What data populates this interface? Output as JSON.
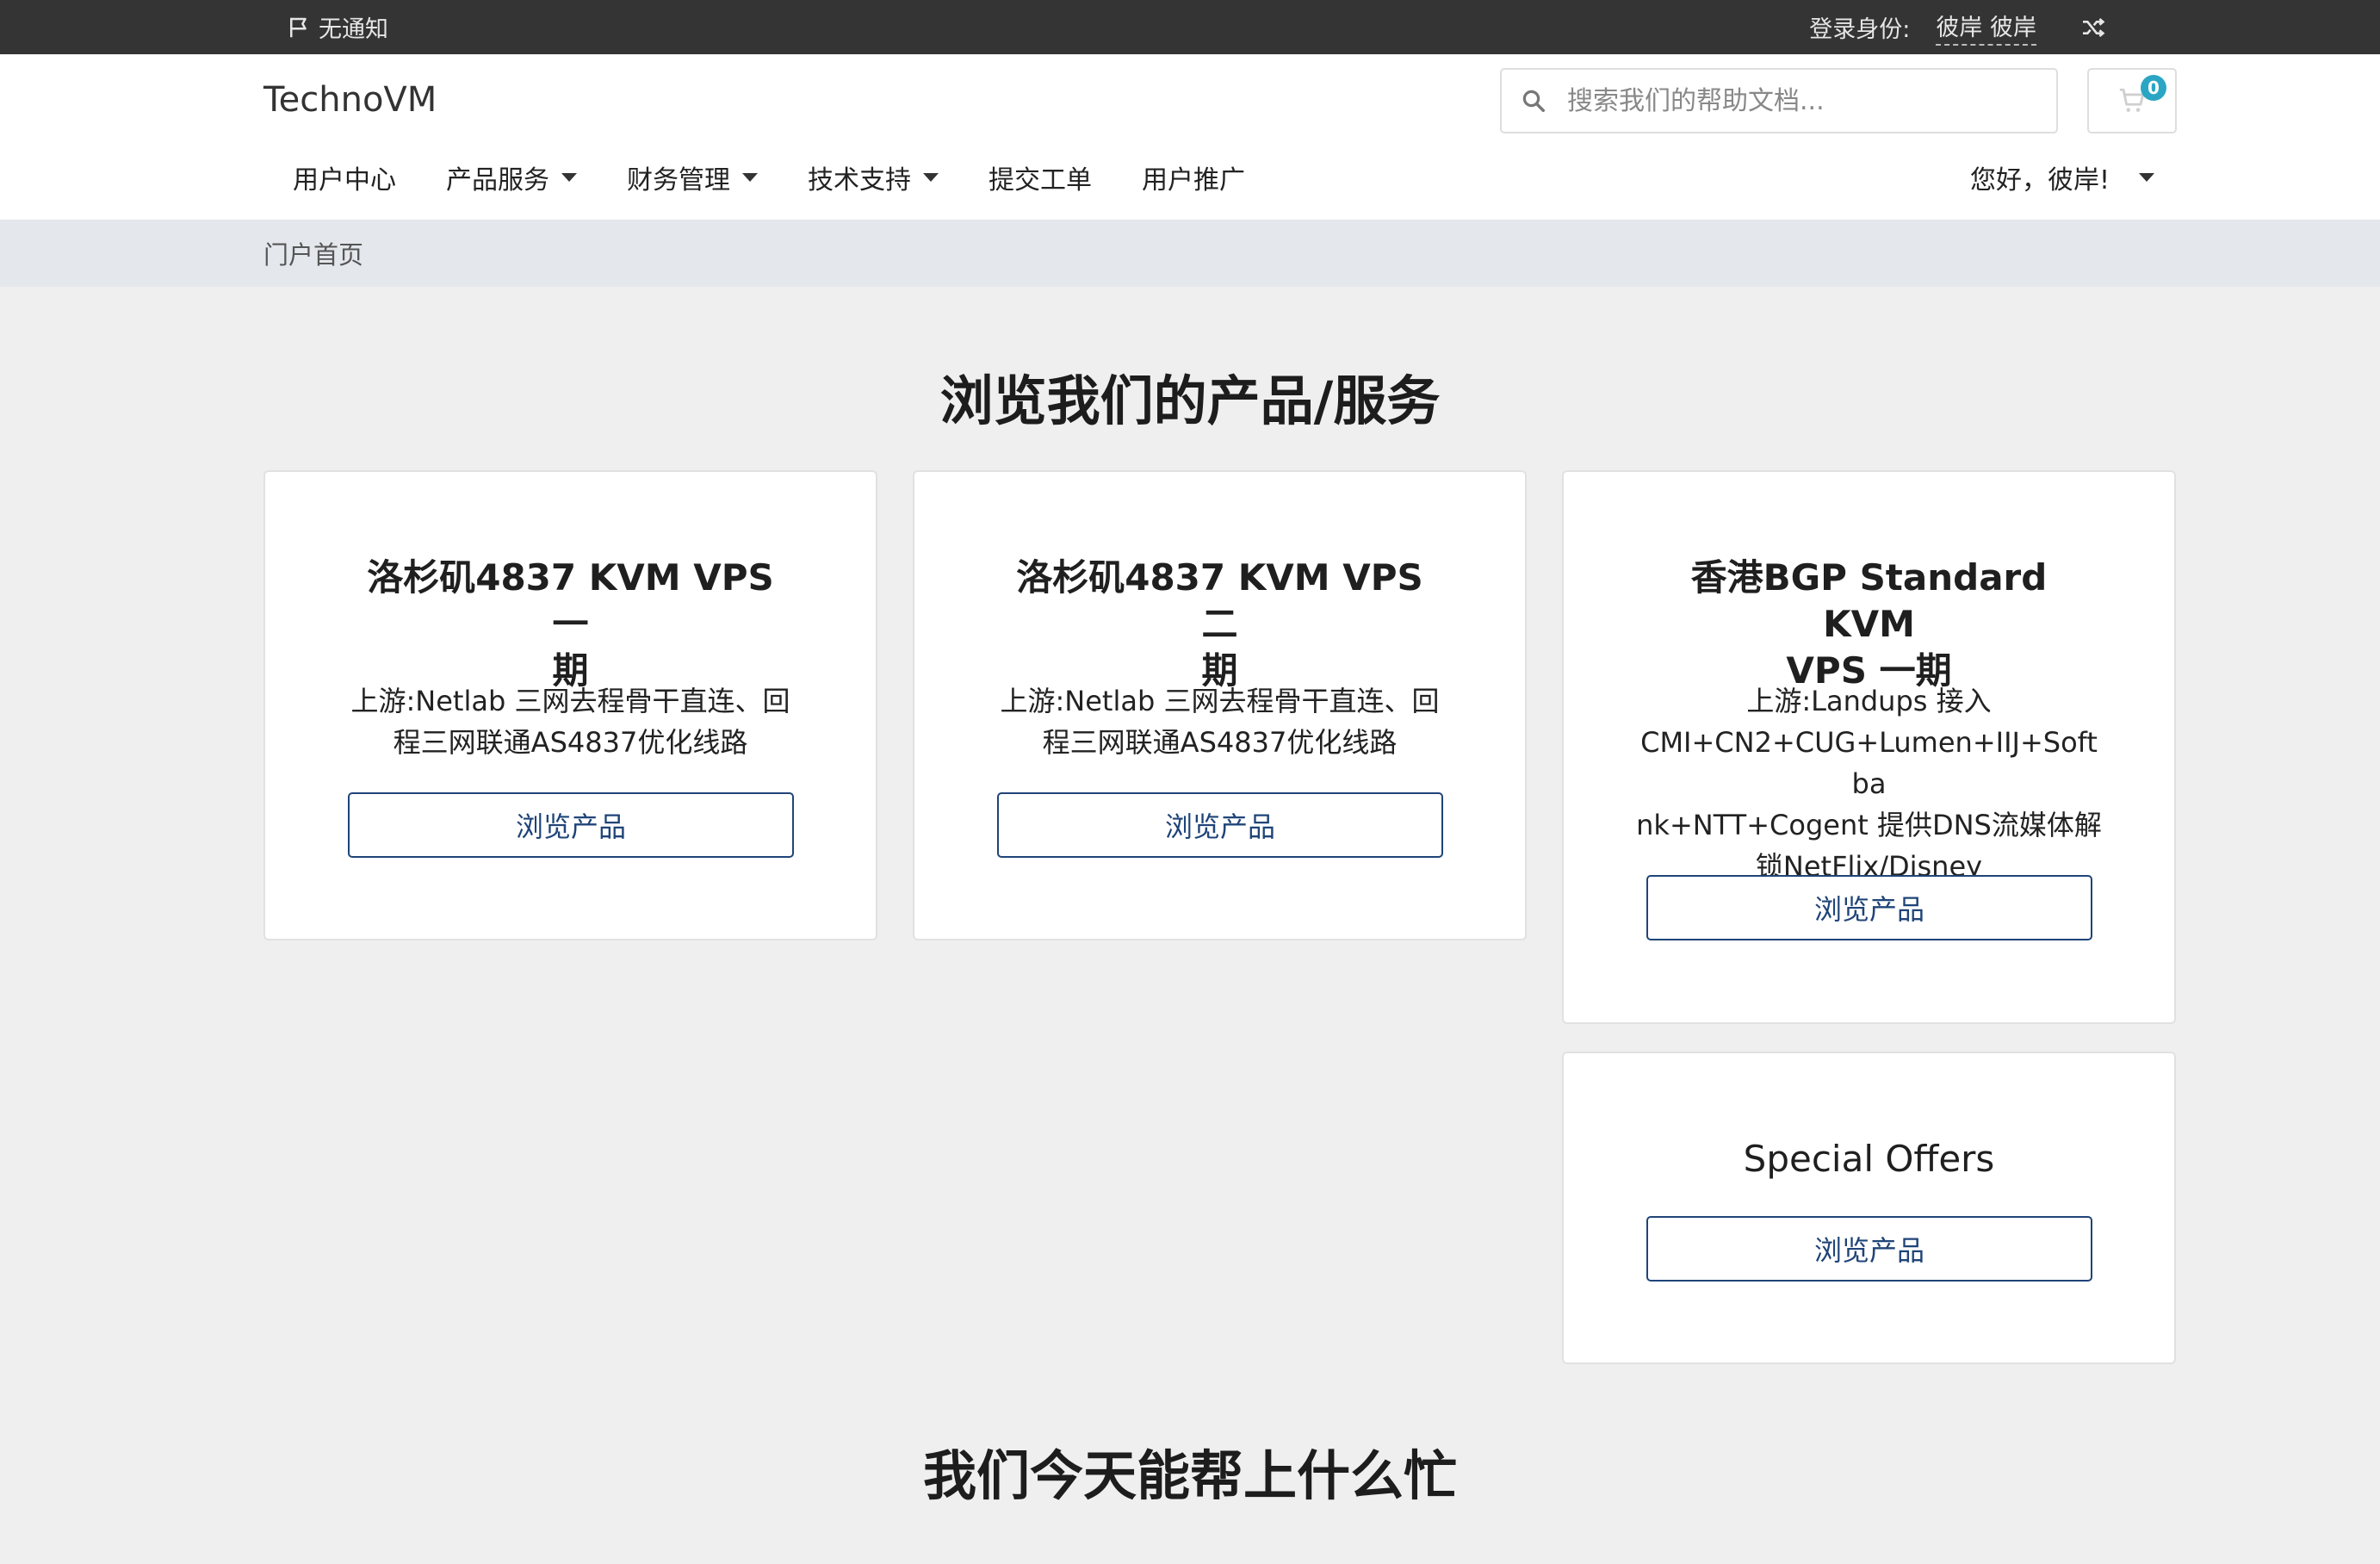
{
  "topbar": {
    "notification": "无通知",
    "login_label": "登录身份:",
    "login_user": "彼岸 彼岸"
  },
  "header": {
    "brand": "TechnoVM",
    "search_placeholder": "搜索我们的帮助文档...",
    "cart_count": "0"
  },
  "nav": {
    "items": [
      {
        "label": "用户中心",
        "dropdown": false
      },
      {
        "label": "产品服务",
        "dropdown": true
      },
      {
        "label": "财务管理",
        "dropdown": true
      },
      {
        "label": "技术支持",
        "dropdown": true
      },
      {
        "label": "提交工单",
        "dropdown": false
      },
      {
        "label": "用户推广",
        "dropdown": false
      }
    ],
    "greeting": "您好，彼岸!"
  },
  "breadcrumb": {
    "home": "门户首页"
  },
  "products": {
    "heading": "浏览我们的产品/服务",
    "cards": [
      {
        "title_line1": "洛杉矶4837 KVM VPS 一",
        "title_line2": "期",
        "desc_line1": "上游:Netlab 三网去程骨干直连、回",
        "desc_line2": "程三网联通AS4837优化线路",
        "button": "浏览产品"
      },
      {
        "title_line1": "洛杉矶4837 KVM VPS 二",
        "title_line2": "期",
        "desc_line1": "上游:Netlab 三网去程骨干直连、回",
        "desc_line2": "程三网联通AS4837优化线路",
        "button": "浏览产品"
      },
      {
        "title_line1": "香港BGP Standard KVM",
        "title_line2": "VPS 一期",
        "desc_line1": "上游:Landups 接入",
        "desc_line2": "CMI+CN2+CUG+Lumen+IIJ+Softba",
        "desc_line3": "nk+NTT+Cogent 提供DNS流媒体解",
        "desc_line4": "锁NetFlix/Disney",
        "button": "浏览产品"
      },
      {
        "title_line1": "Special Offers",
        "button": "浏览产品"
      }
    ]
  },
  "help": {
    "heading": "我们今天能帮上什么忙"
  },
  "colors": {
    "topbar_bg": "#343434",
    "accent_blue": "#1f4478",
    "badge": "#2aa6c4",
    "page_bg": "#efefef"
  }
}
